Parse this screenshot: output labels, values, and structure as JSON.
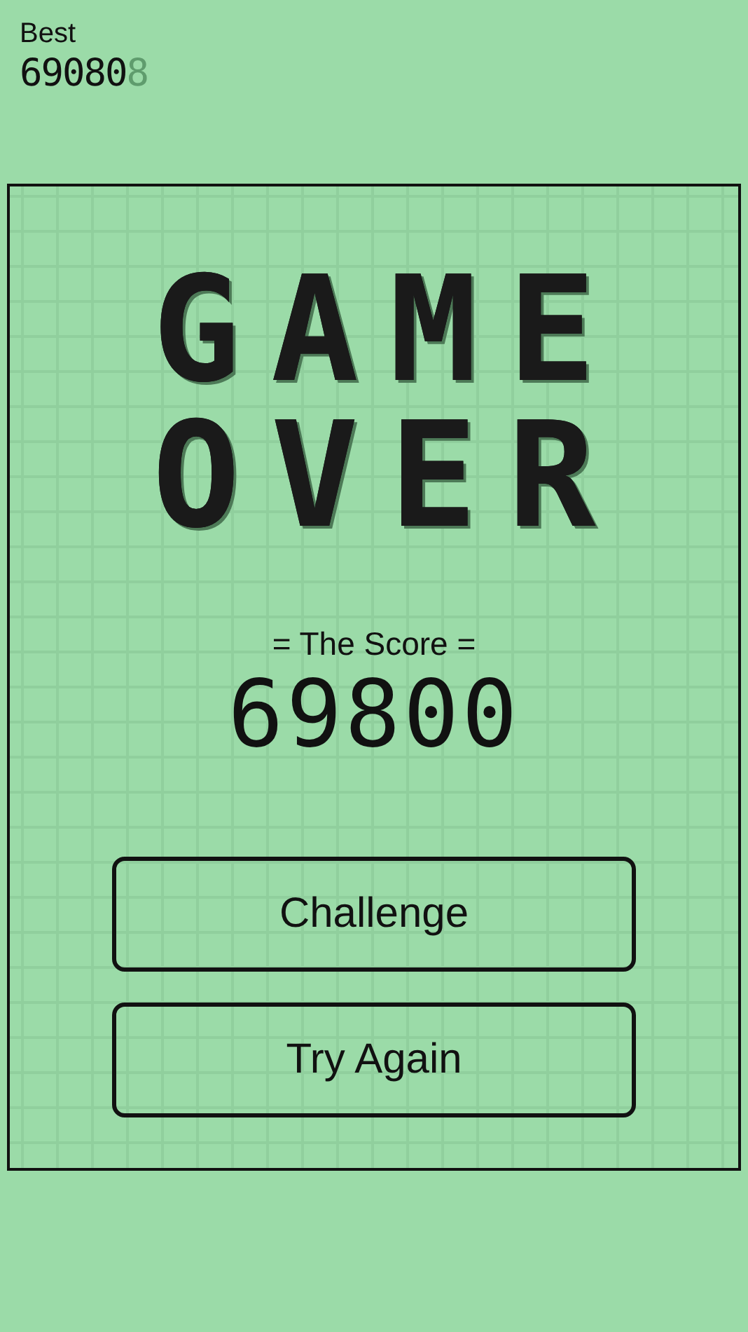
{
  "best": {
    "label": "Best",
    "value": "69080",
    "ghost_digit": "8"
  },
  "title_lines": [
    "GAME",
    "OVER"
  ],
  "score": {
    "label": "= The Score =",
    "value": "69800"
  },
  "buttons": [
    {
      "label": "Challenge"
    },
    {
      "label": "Try Again"
    }
  ]
}
